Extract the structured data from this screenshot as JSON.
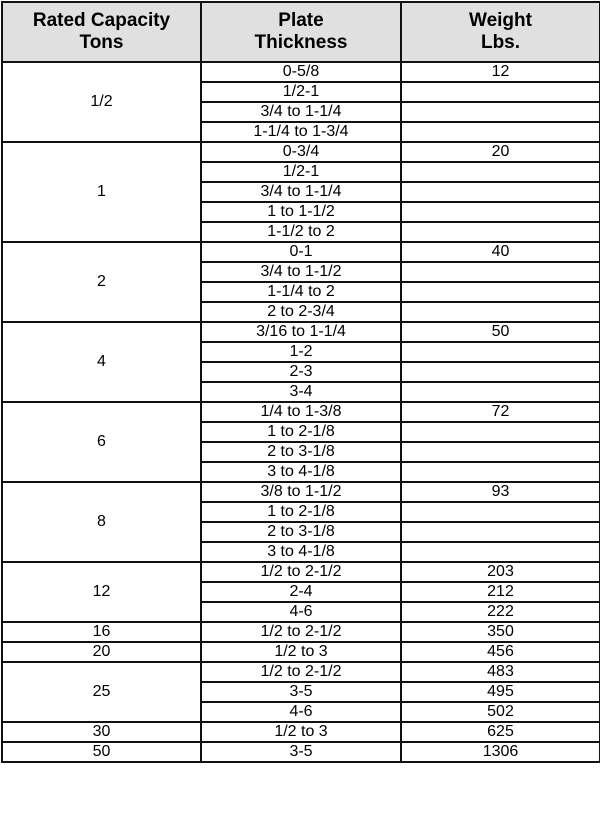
{
  "table": {
    "headers": [
      {
        "line1": "Rated Capacity",
        "line2": "Tons"
      },
      {
        "line1": "Plate",
        "line2": "Thickness"
      },
      {
        "line1": "Weight",
        "line2": "Lbs."
      }
    ],
    "groups": [
      {
        "capacity": "1/2",
        "rows": [
          {
            "thickness": "0-5/8",
            "weight": "12"
          },
          {
            "thickness": "1/2-1",
            "weight": ""
          },
          {
            "thickness": "3/4 to 1-1/4",
            "weight": ""
          },
          {
            "thickness": "1-1/4 to 1-3/4",
            "weight": ""
          }
        ]
      },
      {
        "capacity": "1",
        "rows": [
          {
            "thickness": "0-3/4",
            "weight": "20"
          },
          {
            "thickness": "1/2-1",
            "weight": ""
          },
          {
            "thickness": "3/4 to 1-1/4",
            "weight": ""
          },
          {
            "thickness": "1 to 1-1/2",
            "weight": ""
          },
          {
            "thickness": "1-1/2 to 2",
            "weight": ""
          }
        ]
      },
      {
        "capacity": "2",
        "rows": [
          {
            "thickness": "0-1",
            "weight": "40"
          },
          {
            "thickness": "3/4 to 1-1/2",
            "weight": ""
          },
          {
            "thickness": "1-1/4 to 2",
            "weight": ""
          },
          {
            "thickness": "2 to 2-3/4",
            "weight": ""
          }
        ]
      },
      {
        "capacity": "4",
        "rows": [
          {
            "thickness": "3/16 to 1-1/4",
            "weight": "50"
          },
          {
            "thickness": "1-2",
            "weight": ""
          },
          {
            "thickness": "2-3",
            "weight": ""
          },
          {
            "thickness": "3-4",
            "weight": ""
          }
        ]
      },
      {
        "capacity": "6",
        "rows": [
          {
            "thickness": "1/4 to 1-3/8",
            "weight": "72"
          },
          {
            "thickness": "1 to 2-1/8",
            "weight": ""
          },
          {
            "thickness": "2 to 3-1/8",
            "weight": ""
          },
          {
            "thickness": "3 to 4-1/8",
            "weight": ""
          }
        ]
      },
      {
        "capacity": "8",
        "rows": [
          {
            "thickness": "3/8 to 1-1/2",
            "weight": "93"
          },
          {
            "thickness": "1 to 2-1/8",
            "weight": ""
          },
          {
            "thickness": "2 to 3-1/8",
            "weight": ""
          },
          {
            "thickness": "3 to 4-1/8",
            "weight": ""
          }
        ]
      },
      {
        "capacity": "12",
        "rows": [
          {
            "thickness": "1/2 to 2-1/2",
            "weight": "203"
          },
          {
            "thickness": "2-4",
            "weight": "212"
          },
          {
            "thickness": "4-6",
            "weight": "222"
          }
        ]
      },
      {
        "capacity": "16",
        "rows": [
          {
            "thickness": "1/2 to 2-1/2",
            "weight": "350"
          }
        ]
      },
      {
        "capacity": "20",
        "rows": [
          {
            "thickness": "1/2 to 3",
            "weight": "456"
          }
        ]
      },
      {
        "capacity": "25",
        "rows": [
          {
            "thickness": "1/2 to 2-1/2",
            "weight": "483"
          },
          {
            "thickness": "3-5",
            "weight": "495"
          },
          {
            "thickness": "4-6",
            "weight": "502"
          }
        ]
      },
      {
        "capacity": "30",
        "rows": [
          {
            "thickness": "1/2 to 3",
            "weight": "625"
          }
        ]
      },
      {
        "capacity": "50",
        "rows": [
          {
            "thickness": "3-5",
            "weight": "1306"
          }
        ]
      }
    ]
  }
}
